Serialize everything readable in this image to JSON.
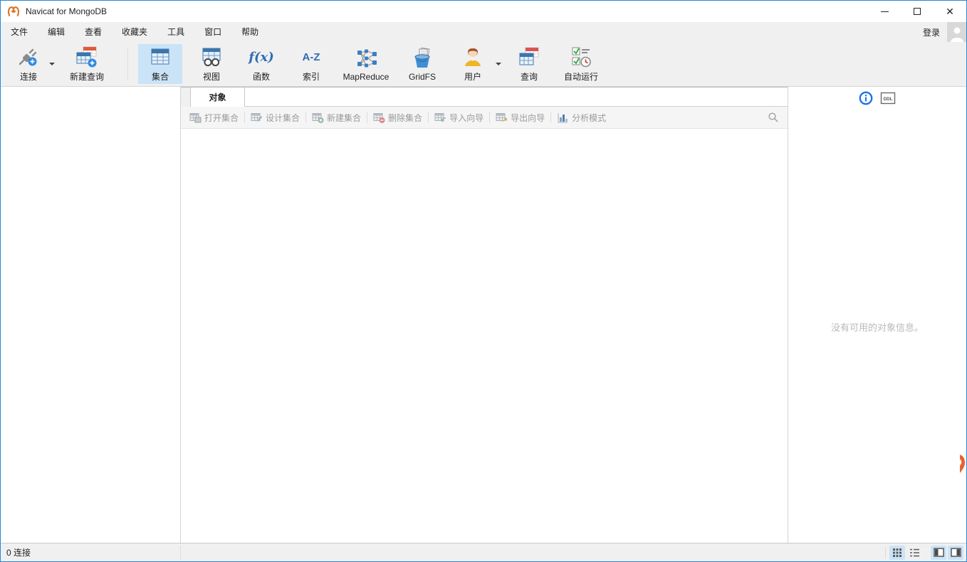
{
  "window": {
    "title": "Navicat for MongoDB"
  },
  "titlebar": {
    "controls": {
      "minimize": "minimize",
      "maximize": "maximize",
      "close": "close"
    }
  },
  "menu": {
    "items": [
      "文件",
      "编辑",
      "查看",
      "收藏夹",
      "工具",
      "窗口",
      "帮助"
    ],
    "login_label": "登录"
  },
  "toolbar": {
    "buttons": [
      {
        "label": "连接",
        "icon": "connection-plug-icon",
        "has_dropdown": true,
        "selected": false
      },
      {
        "label": "新建查询",
        "icon": "new-query-table-icon",
        "has_dropdown": false,
        "selected": false
      },
      {
        "label": "集合",
        "icon": "collection-table-icon",
        "has_dropdown": false,
        "selected": true
      },
      {
        "label": "视图",
        "icon": "view-table-glasses-icon",
        "has_dropdown": false,
        "selected": false
      },
      {
        "label": "函数",
        "icon": "function-icon",
        "glyph": "f(x)",
        "has_dropdown": false,
        "selected": false
      },
      {
        "label": "索引",
        "icon": "index-icon",
        "glyph": "A-Z",
        "has_dropdown": false,
        "selected": false
      },
      {
        "label": "MapReduce",
        "icon": "mapreduce-tree-icon",
        "has_dropdown": false,
        "selected": false
      },
      {
        "label": "GridFS",
        "icon": "gridfs-bucket-icon",
        "has_dropdown": false,
        "selected": false
      },
      {
        "label": "用户",
        "icon": "user-person-icon",
        "has_dropdown": true,
        "selected": false
      },
      {
        "label": "查询",
        "icon": "query-table-icon",
        "has_dropdown": false,
        "selected": false
      },
      {
        "label": "自动运行",
        "icon": "automation-checklist-clock-icon",
        "has_dropdown": false,
        "selected": false
      }
    ]
  },
  "tabs": {
    "objects": "对象"
  },
  "object_toolbar": {
    "items": [
      "打开集合",
      "设计集合",
      "新建集合",
      "删除集合",
      "导入向导",
      "导出向导",
      "分析模式"
    ],
    "search_icon": "search-icon"
  },
  "right_panel": {
    "info_icon": "info-icon",
    "ddl_label": "DDL",
    "empty_message": "没有可用的对象信息。"
  },
  "statusbar": {
    "connections": "0 连接",
    "icons": [
      "grid-view-icon",
      "list-view-icon",
      "left-panel-toggle-icon",
      "right-panel-toggle-icon"
    ]
  },
  "colors": {
    "accent_border": "#2787d8",
    "selected_button_bg": "#cbe3f7",
    "icon_blue": "#2f6db5",
    "logo_orange": "#e8702d",
    "disabled_text": "#9b9b9b",
    "empty_text": "#b9b9b9"
  }
}
